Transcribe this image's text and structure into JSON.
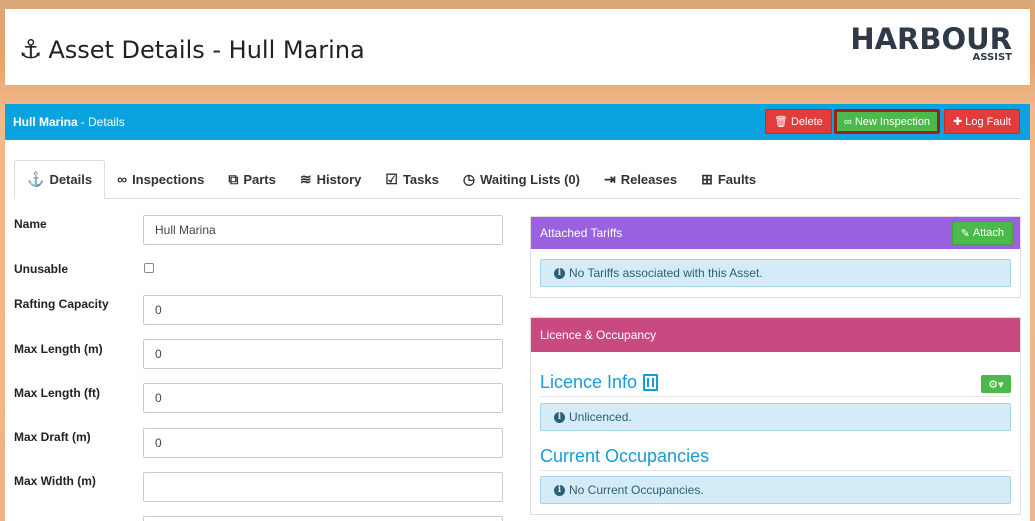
{
  "header": {
    "anchor_icon": "anchor-icon",
    "title": "Asset Details - Hull Marina",
    "logo_brand": "HARBOUR",
    "logo_sub": "ASSIST"
  },
  "panel": {
    "asset_name": "Hull Marina",
    "subtitle": "- Details",
    "buttons": {
      "delete": "Delete",
      "new_inspection": "New Inspection",
      "log_fault": "Log Fault"
    }
  },
  "tabs": [
    {
      "label": "Details",
      "icon": "anchor-icon",
      "active": true
    },
    {
      "label": "Inspections",
      "icon": "glasses-icon"
    },
    {
      "label": "Parts",
      "icon": "puzzle-icon"
    },
    {
      "label": "History",
      "icon": "layers-icon"
    },
    {
      "label": "Tasks",
      "icon": "clipboard-check-icon"
    },
    {
      "label": "Waiting Lists (0)",
      "icon": "clock-icon"
    },
    {
      "label": "Releases",
      "icon": "sign-out-icon"
    },
    {
      "label": "Faults",
      "icon": "medkit-icon"
    }
  ],
  "form": {
    "name_label": "Name",
    "name_value": "Hull Marina",
    "unusable_label": "Unusable",
    "rafting_label": "Rafting Capacity",
    "rafting_value": "0",
    "max_length_m_label": "Max Length (m)",
    "max_length_m_value": "0",
    "max_length_ft_label": "Max Length (ft)",
    "max_length_ft_value": "0",
    "max_draft_label": "Max Draft (m)",
    "max_draft_value": "0",
    "max_width_label": "Max Width (m)",
    "max_width_value": ""
  },
  "tariffs": {
    "title": "Attached Tariffs",
    "attach_label": "Attach",
    "empty_message": "No Tariffs associated with this Asset."
  },
  "licence": {
    "title": "Licence & Occupancy",
    "licence_info_title": "Licence Info",
    "licence_message": "Unlicenced.",
    "occupancies_title": "Current Occupancies",
    "occupancies_message": "No Current Occupancies."
  },
  "colors": {
    "header_blue": "#0aa3df",
    "tariff_purple": "#9a62e0",
    "licence_pink": "#c84a80",
    "danger_red": "#e23c3c",
    "success_green": "#4bb94b",
    "info_text": "#1a9ad6"
  }
}
